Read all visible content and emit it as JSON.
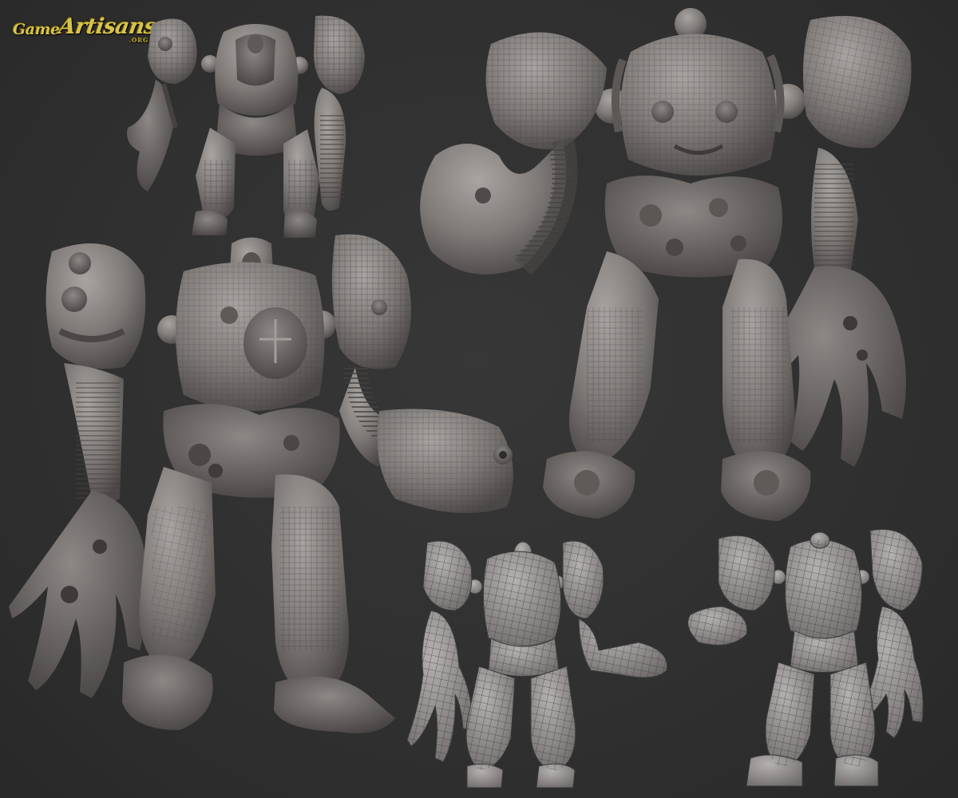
{
  "logo": {
    "word1": "Game",
    "word2": "Artisans",
    "suffix": ".ORG"
  },
  "colors": {
    "background": "#303030",
    "sculpt": "#8e8a88",
    "sculpt_dark": "#4a4746",
    "wire_fill": "#9a9796",
    "wire_line": "#3c3c3c",
    "logo": "#d6c34a"
  },
  "figures": [
    {
      "name": "sculpt-small-front",
      "render": "sculpted"
    },
    {
      "name": "sculpt-large-back",
      "render": "sculpted"
    },
    {
      "name": "sculpt-large-front",
      "render": "sculpted"
    },
    {
      "name": "wireframe-front",
      "render": "wireframe"
    },
    {
      "name": "wireframe-back",
      "render": "wireframe"
    }
  ]
}
